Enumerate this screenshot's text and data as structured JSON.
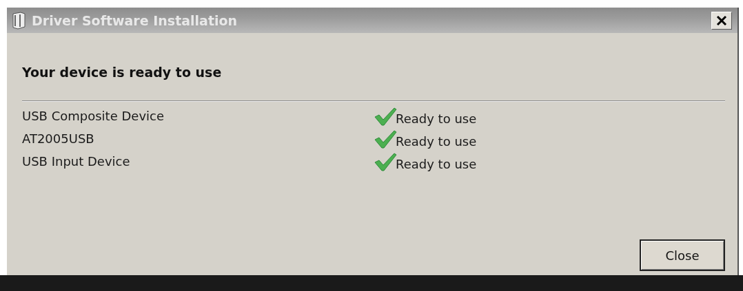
{
  "window": {
    "title": "Driver Software Installation"
  },
  "heading": "Your device is ready to use",
  "devices": [
    {
      "name": "USB Composite Device",
      "status": "Ready to use"
    },
    {
      "name": "AT2005USB",
      "status": "Ready to use"
    },
    {
      "name": "USB Input Device",
      "status": "Ready to use"
    }
  ],
  "buttons": [
    "Close"
  ]
}
